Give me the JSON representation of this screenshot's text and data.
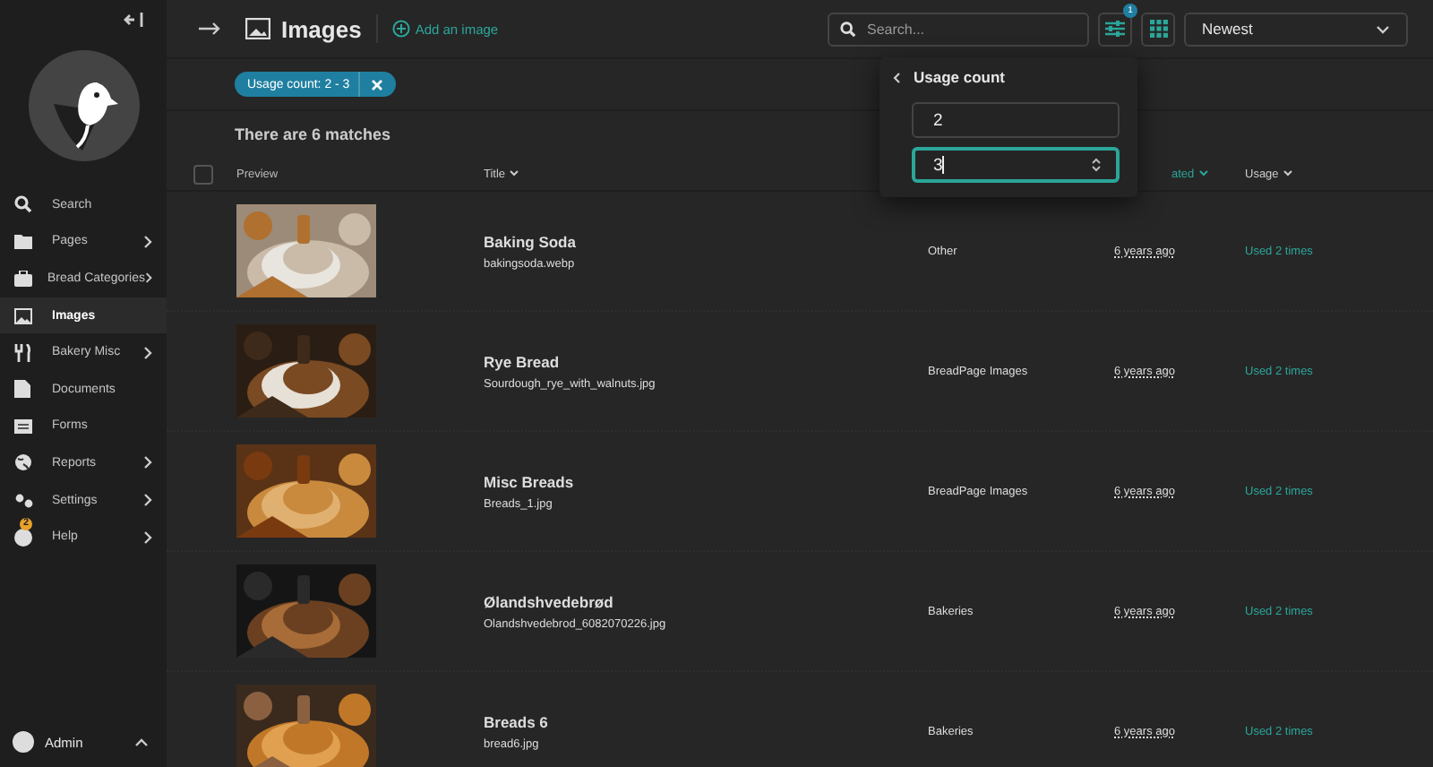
{
  "sidebar": {
    "items": [
      {
        "label": "Search",
        "expandable": false,
        "selected": false
      },
      {
        "label": "Pages",
        "expandable": true,
        "selected": false
      },
      {
        "label": "Bread Categories",
        "expandable": true,
        "selected": false
      },
      {
        "label": "Images",
        "expandable": false,
        "selected": true
      },
      {
        "label": "Bakery Misc",
        "expandable": true,
        "selected": false
      },
      {
        "label": "Documents",
        "expandable": false,
        "selected": false
      },
      {
        "label": "Forms",
        "expandable": false,
        "selected": false
      },
      {
        "label": "Reports",
        "expandable": true,
        "selected": false
      },
      {
        "label": "Settings",
        "expandable": true,
        "selected": false
      },
      {
        "label": "Help",
        "expandable": true,
        "selected": false,
        "badge": "2"
      }
    ],
    "user": "Admin"
  },
  "header": {
    "title": "Images",
    "add_link": "Add an image",
    "search": {
      "placeholder": "Search..."
    },
    "filter_badge": "1",
    "sort": "Newest"
  },
  "active_filter": "Usage count: 2 - 3",
  "matches": "There are 6 matches",
  "table": {
    "select_all": {
      "checked": false
    },
    "columns": [
      {
        "label": "Preview",
        "sortable": false
      },
      {
        "label": "Title",
        "sortable": true
      },
      {
        "label": "ated",
        "sortable": true
      },
      {
        "label": "Usage",
        "sortable": true
      }
    ],
    "rows": [
      {
        "title": "Baking Soda",
        "file": "bakingsoda.webp",
        "collection": "Other",
        "created": "6 years ago",
        "usage": "Used 2 times"
      },
      {
        "title": "Rye Bread",
        "file": "Sourdough_rye_with_walnuts.jpg",
        "collection": "BreadPage Images",
        "created": "6 years ago",
        "usage": "Used 2 times"
      },
      {
        "title": "Misc Breads",
        "file": "Breads_1.jpg",
        "collection": "BreadPage Images",
        "created": "6 years ago",
        "usage": "Used 2 times"
      },
      {
        "title": "Ølandshvedebrød",
        "file": "Olandshvedebrod_6082070226.jpg",
        "collection": "Bakeries",
        "created": "6 years ago",
        "usage": "Used 2 times"
      },
      {
        "title": "Breads 6",
        "file": "bread6.jpg",
        "collection": "Bakeries",
        "created": "6 years ago",
        "usage": "Used 2 times"
      }
    ]
  },
  "popup": {
    "title": "Usage count",
    "fields": [
      {
        "value": "2",
        "focused": false
      },
      {
        "value": "3",
        "focused": true
      }
    ]
  }
}
